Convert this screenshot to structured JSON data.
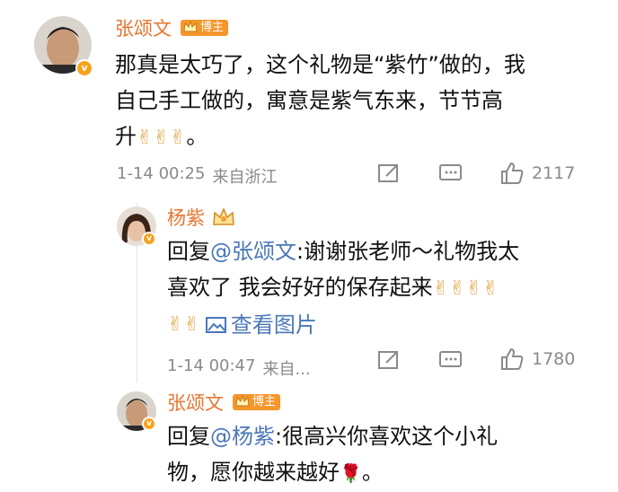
{
  "comment": {
    "author": "张颂文",
    "badge_label": "博主",
    "text_line1": "那真是太巧了，这个礼物是“紫竹”做的，我",
    "text_line2": "自己手工做的，寓意是紫气东来，节节高",
    "text_line3_prefix": "升",
    "text_line3_emoji": "✌✌✌",
    "text_line3_suffix": "。",
    "time": "1-14 00:25",
    "location": "来自浙江",
    "like_count": "2117"
  },
  "replies": [
    {
      "author": "杨紫",
      "reply_prefix": "回复",
      "mention": "@张颂文",
      "text_line1": ":谢谢张老师～礼物我太",
      "text_line2": "喜欢了 我会好好的保存起来",
      "text_line2_emoji": "✌✌✌✌",
      "text_line3_emoji": "✌✌",
      "view_image_label": "查看图片",
      "time": "1-14 00:47",
      "location": "来自...",
      "like_count": "1780"
    },
    {
      "author": "张颂文",
      "badge_label": "博主",
      "reply_prefix": "回复",
      "mention": "@杨紫",
      "text_line1": ":很高兴你喜欢这个小礼",
      "text_line2": "物，愿你越来越好",
      "text_line2_emoji": "🌹",
      "text_line2_suffix": "。"
    }
  ],
  "colors": {
    "name": "#e8742c",
    "link": "#4a78b8",
    "meta": "#8a8a8a",
    "badge": "#f5962b"
  }
}
